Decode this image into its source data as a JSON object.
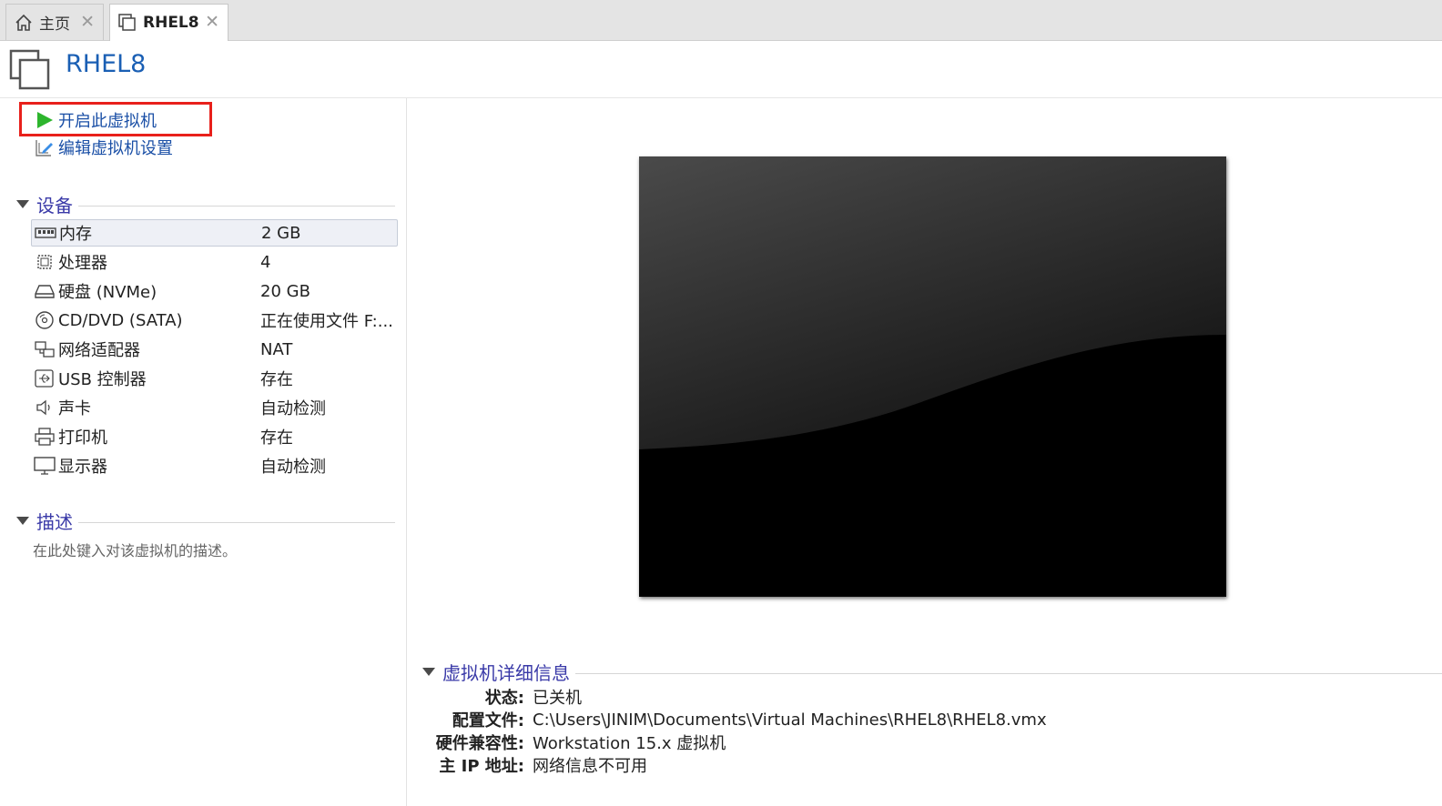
{
  "tabs": [
    {
      "label": "主页",
      "icon": "home-icon"
    },
    {
      "label": "RHEL8",
      "icon": "vm-icon",
      "active": true
    }
  ],
  "header": {
    "title": "RHEL8"
  },
  "actions": {
    "start": "开启此虚拟机",
    "edit": "编辑虚拟机设置"
  },
  "devices": {
    "section_title": "设备",
    "items": [
      {
        "name": "内存",
        "value": "2 GB",
        "icon": "memory-icon"
      },
      {
        "name": "处理器",
        "value": "4",
        "icon": "cpu-icon"
      },
      {
        "name": "硬盘 (NVMe)",
        "value": "20 GB",
        "icon": "harddisk-icon"
      },
      {
        "name": "CD/DVD (SATA)",
        "value": "正在使用文件 F:...",
        "icon": "cd-icon"
      },
      {
        "name": "网络适配器",
        "value": "NAT",
        "icon": "network-icon"
      },
      {
        "name": "USB 控制器",
        "value": "存在",
        "icon": "usb-icon"
      },
      {
        "name": "声卡",
        "value": "自动检测",
        "icon": "speaker-icon"
      },
      {
        "name": "打印机",
        "value": "存在",
        "icon": "printer-icon"
      },
      {
        "name": "显示器",
        "value": "自动检测",
        "icon": "monitor-icon"
      }
    ]
  },
  "description": {
    "section_title": "描述",
    "placeholder": "在此处键入对该虚拟机的描述。"
  },
  "details": {
    "section_title": "虚拟机详细信息",
    "rows": [
      {
        "label": "状态:",
        "value": "已关机"
      },
      {
        "label": "配置文件:",
        "value": "C:\\Users\\JINIM\\Documents\\Virtual Machines\\RHEL8\\RHEL8.vmx"
      },
      {
        "label": "硬件兼容性:",
        "value": "Workstation 15.x 虚拟机"
      },
      {
        "label": "主 IP 地址:",
        "value": "网络信息不可用"
      }
    ]
  },
  "colors": {
    "link": "#1a4fa6",
    "section_title": "#3a3aa8",
    "highlight": "#e8201b",
    "play": "#2db52d"
  }
}
